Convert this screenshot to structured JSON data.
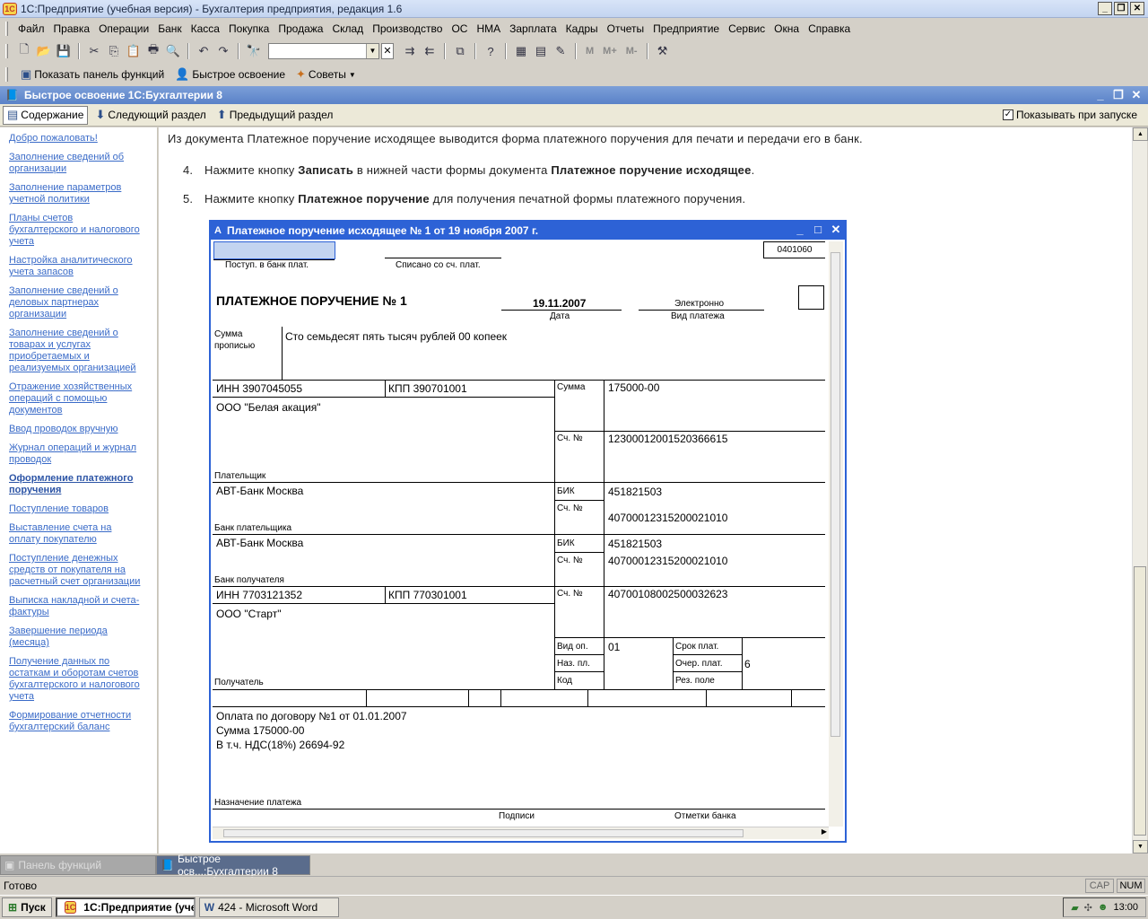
{
  "window": {
    "title": "1С:Предприятие (учебная версия) - Бухгалтерия предприятия, редакция 1.6",
    "app_icon": "1С"
  },
  "menu": [
    "Файл",
    "Правка",
    "Операции",
    "Банк",
    "Касса",
    "Покупка",
    "Продажа",
    "Склад",
    "Производство",
    "ОС",
    "НМА",
    "Зарплата",
    "Кадры",
    "Отчеты",
    "Предприятие",
    "Сервис",
    "Окна",
    "Справка"
  ],
  "toolbar2": {
    "show_panel": "Показать панель функций",
    "quick_learn": "Быстрое освоение",
    "tips": "Советы"
  },
  "inner_window": {
    "title": "Быстрое освоение 1С:Бухгалтерии 8",
    "contents": "Содержание",
    "next_section": "Следующий раздел",
    "prev_section": "Предыдущий раздел",
    "show_on_start": "Показывать при запуске"
  },
  "sidebar": [
    {
      "label": "Добро пожаловать!"
    },
    {
      "label": "Заполнение сведений об организации"
    },
    {
      "label": "Заполнение параметров учетной политики"
    },
    {
      "label": "Планы счетов бухгалтерского и налогового учета"
    },
    {
      "label": "Настройка аналитического учета запасов"
    },
    {
      "label": "Заполнение сведений о деловых партнерах организации"
    },
    {
      "label": "Заполнение сведений о товарах и услугах приобретаемых и реализуемых организацией"
    },
    {
      "label": "Отражение хозяйственных операций с помощью документов"
    },
    {
      "label": "Ввод проводок вручную"
    },
    {
      "label": "Журнал операций и журнал проводок"
    },
    {
      "label": "Оформление платежного поручения",
      "active": true
    },
    {
      "label": "Поступление товаров"
    },
    {
      "label": "Выставление счета на оплату покупателю"
    },
    {
      "label": "Поступление денежных средств от покупателя на расчетный счет организации"
    },
    {
      "label": "Выписка накладной и счета-фактуры"
    },
    {
      "label": "Завершение периода (месяца)"
    },
    {
      "label": "Получение данных по остаткам и оборотам счетов бухгалтерского и налогового учета"
    },
    {
      "label": "Формирование отчетности бухгалтерский баланс"
    }
  ],
  "content": {
    "intro": "Из документа Платежное поручение исходящее выводится форма платежного поручения для печати и передачи его в банк.",
    "step4": {
      "num": "4.",
      "pre": "Нажмите кнопку ",
      "b1": "Записать",
      "mid": " в нижней части формы документа ",
      "b2": "Платежное поручение исходящее",
      "post": "."
    },
    "step5": {
      "num": "5.",
      "pre": "Нажмите кнопку ",
      "b1": "Платежное поручение",
      "post": " для получения печатной формы платежного поручения."
    }
  },
  "doc": {
    "title": "Платежное поручение исходящее № 1 от 19 ноября 2007 г.",
    "form_code": "0401060",
    "received": "Поступ. в банк плат.",
    "debited": "Списано со сч. плат.",
    "heading": "ПЛАТЕЖНОЕ ПОРУЧЕНИЕ № 1",
    "date": "19.11.2007",
    "date_label": "Дата",
    "pay_type": "Электронно",
    "pay_type_label": "Вид платежа",
    "sum_words_label1": "Сумма",
    "sum_words_label2": "прописью",
    "sum_words": "Сто семьдесят пять тысяч рублей 00 копеек",
    "payer_inn": "ИНН 3907045055",
    "payer_kpp": "КПП 390701001",
    "sum_label": "Сумма",
    "sum": "175000-00",
    "payer_name": "ООО \"Белая акация\"",
    "acc_label": "Сч. №",
    "payer_acc": "12300012001520366615",
    "payer_label": "Плательщик",
    "payer_bank": "АВТ-Банк Москва",
    "bik_label": "БИК",
    "payer_bik": "451821503",
    "payer_bank_acc": "40700012315200021010",
    "payer_bank_label": "Банк плательщика",
    "payee_bank": "АВТ-Банк Москва",
    "payee_bik": "451821503",
    "payee_bank_acc": "40700012315200021010",
    "payee_bank_label": "Банк получателя",
    "payee_inn": "ИНН 7703121352",
    "payee_kpp": "КПП 770301001",
    "payee_acc": "40700108002500032623",
    "payee_name": "ООО \"Старт\"",
    "op_type_label": "Вид оп.",
    "op_type": "01",
    "term_label": "Срок плат.",
    "purpose_label": "Наз. пл.",
    "order_label": "Очер. плат.",
    "order": "6",
    "code_label": "Код",
    "reserve_label": "Рез. поле",
    "payee_label": "Получатель",
    "purpose1": "Оплата по договору №1 от 01.01.2007",
    "purpose2": "Сумма 175000-00",
    "purpose3": "В т.ч. НДС(18%) 26694-92",
    "purpose_field_label": "Назначение платежа",
    "signatures": "Подписи",
    "bank_marks": "Отметки банка"
  },
  "window_tabs": {
    "functions_panel": "Панель функций",
    "quick_learn": "Быстрое осв...:Бухгалтерии 8"
  },
  "status": {
    "ready": "Готово",
    "cap": "CAP",
    "num": "NUM"
  },
  "taskbar": {
    "start": "Пуск",
    "app_1c": "1С:Предприятие (уче...",
    "word": "424 - Microsoft Word",
    "clock": "13:00"
  }
}
